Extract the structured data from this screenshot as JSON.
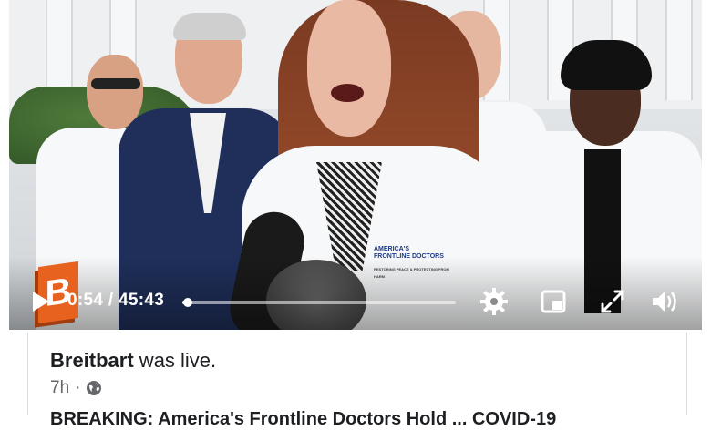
{
  "player": {
    "logo_letter": "B",
    "current_time": "0:54",
    "separator": "/",
    "duration": "45:43",
    "progress_fraction": 0.02,
    "controls": [
      "play-icon",
      "gear-icon",
      "miniplayer-icon",
      "fullscreen-icon",
      "volume-icon"
    ]
  },
  "post": {
    "author": "Breitbart",
    "action": " was live.",
    "age": "7h",
    "dot": "·",
    "audience_icon": "globe-icon",
    "text_preview": "BREAKING: America's Frontline Doctors Hold ... COVID-19"
  },
  "badge": {
    "line1": "AMERICA'S",
    "line2": "FRONTLINE DOCTORS",
    "tagline": "RESTORING PEACE & PROTECTING FROM HARM"
  },
  "colors": {
    "accent": "#e8621f",
    "text": "#1c1e21",
    "meta": "#65676b"
  }
}
